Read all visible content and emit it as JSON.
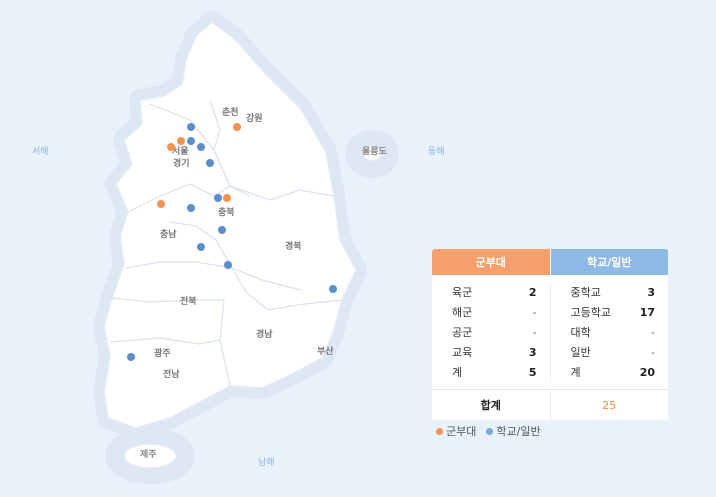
{
  "colors": {
    "military": "#f5924e",
    "school": "#5a8fcb"
  },
  "seas": {
    "west": "서해",
    "east": "동해",
    "south": "남해"
  },
  "regions": {
    "chuncheon": "춘천",
    "gangwon": "강원",
    "seoul": "서울",
    "gyeonggi": "경기",
    "chungbuk": "충북",
    "chungnam": "충남",
    "gyeongbuk": "경북",
    "jeonbuk": "전북",
    "gyeongnam": "경남",
    "busan": "부산",
    "gwangju": "광주",
    "jeonnam": "전남",
    "jeju": "제주",
    "ulleungdo": "울릉도"
  },
  "markers": [
    {
      "type": "school",
      "label": ""
    },
    {
      "type": "military",
      "label": ""
    },
    {
      "type": "military",
      "label": ""
    },
    {
      "type": "military",
      "label": ""
    },
    {
      "type": "school",
      "label": ""
    },
    {
      "type": "school",
      "label": ""
    },
    {
      "type": "school",
      "label": ""
    },
    {
      "type": "military",
      "label": ""
    },
    {
      "type": "school",
      "label": ""
    },
    {
      "type": "military",
      "label": ""
    },
    {
      "type": "school",
      "label": ""
    },
    {
      "type": "school",
      "label": ""
    },
    {
      "type": "school",
      "label": ""
    },
    {
      "type": "school",
      "label": ""
    },
    {
      "type": "school",
      "label": ""
    },
    {
      "type": "school",
      "label": ""
    }
  ],
  "table": {
    "military_header": "군부대",
    "school_header": "학교/일반",
    "military": [
      {
        "label": "육군",
        "value": "2"
      },
      {
        "label": "해군",
        "value": "-"
      },
      {
        "label": "공군",
        "value": "-"
      },
      {
        "label": "교육",
        "value": "3"
      },
      {
        "label": "계",
        "value": "5"
      }
    ],
    "school": [
      {
        "label": "중학교",
        "value": "3"
      },
      {
        "label": "고등학교",
        "value": "17"
      },
      {
        "label": "대학",
        "value": "-"
      },
      {
        "label": "일반",
        "value": "-"
      },
      {
        "label": "계",
        "value": "20"
      }
    ],
    "total_label": "합계",
    "total_value": "25"
  },
  "legend": {
    "military": "군부대",
    "school": "학교/일반"
  }
}
